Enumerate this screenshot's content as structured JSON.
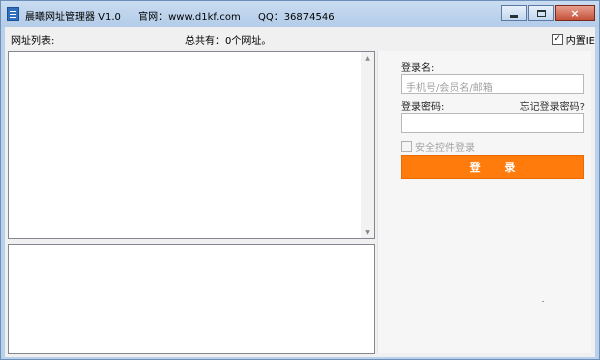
{
  "window": {
    "app_name": "晨曦网址管理器 V1.0",
    "website": "官网：www.d1kf.com",
    "qq": "QQ：36874546",
    "buttons": {
      "minimize_icon": "minimize-icon",
      "maximize_icon": "maximize-icon",
      "close_label": "×"
    }
  },
  "header": {
    "list_label": "网址列表:",
    "total_label": "总共有：0个网址。",
    "builtin_ie_label": "内置IE",
    "builtin_ie_checked": true,
    "check_mark": "✓"
  },
  "login": {
    "username_label": "登录名:",
    "username_placeholder": "手机号/会员名/邮箱",
    "username_value": "",
    "password_label": "登录密码:",
    "forgot_link": "忘记登录密码?",
    "password_value": "",
    "secure_control_label": "安全控件登录",
    "secure_control_checked": false,
    "submit_label": "登 录"
  },
  "scroll": {
    "up_arrow": "▲",
    "down_arrow": "▼"
  },
  "colors": {
    "accent": "#ff7b0c",
    "window_frame": "#b9d1ea"
  }
}
